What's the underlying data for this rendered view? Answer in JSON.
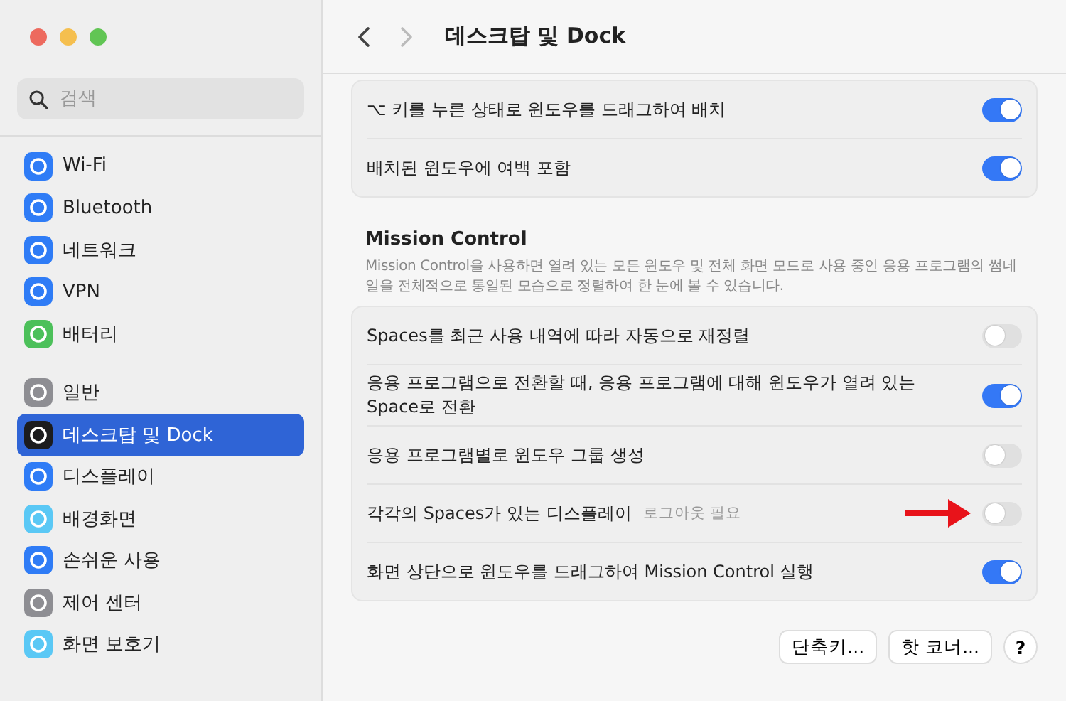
{
  "sidebar": {
    "search": {
      "placeholder": "검색"
    },
    "groups": [
      {
        "items": [
          {
            "label": "Wi-Fi",
            "color": "#2f7cf6",
            "selected": false
          },
          {
            "label": "Bluetooth",
            "color": "#2f7cf6",
            "selected": false
          },
          {
            "label": "네트워크",
            "color": "#2f7cf6",
            "selected": false
          },
          {
            "label": "VPN",
            "color": "#2f7cf6",
            "selected": false
          },
          {
            "label": "배터리",
            "color": "#4cc05a",
            "selected": false
          }
        ]
      },
      {
        "items": [
          {
            "label": "일반",
            "color": "#8e8e93",
            "selected": false
          },
          {
            "label": "데스크탑 및 Dock",
            "color": "#1c1c1e",
            "selected": true
          },
          {
            "label": "디스플레이",
            "color": "#2f7cf6",
            "selected": false
          },
          {
            "label": "배경화면",
            "color": "#5ac8f5",
            "selected": false
          },
          {
            "label": "손쉬운 사용",
            "color": "#2f7cf6",
            "selected": false
          },
          {
            "label": "제어 센터",
            "color": "#8e8e93",
            "selected": false
          },
          {
            "label": "화면 보호기",
            "color": "#5ac8f5",
            "selected": false
          }
        ]
      }
    ]
  },
  "header": {
    "title": "데스크탑 및 Dock"
  },
  "sections": [
    {
      "rows": [
        {
          "label": "⌥ 키를 누른 상태로 윈도우를 드래그하여 배치",
          "on": true,
          "highlighted": false
        },
        {
          "label": "배치된 윈도우에 여백 포함",
          "on": true,
          "highlighted": false
        }
      ]
    },
    {
      "heading": "Mission Control",
      "description": "Mission Control을 사용하면 열려 있는 모든 윈도우 및 전체 화면 모드로 사용 중인 응용 프로그램의 썸네일을 전체적으로 통일된 모습으로 정렬하여 한 눈에 볼 수 있습니다.",
      "rows": [
        {
          "label": "Spaces를 최근 사용 내역에 따라 자동으로 재정렬",
          "on": false,
          "highlighted": false
        },
        {
          "label": "응용 프로그램으로 전환할 때, 응용 프로그램에 대해 윈도우가 열려 있는 Space로 전환",
          "on": true,
          "highlighted": false
        },
        {
          "label": "응용 프로그램별로 윈도우 그룹 생성",
          "on": false,
          "highlighted": false
        },
        {
          "label": "각각의 Spaces가 있는 디스플레이",
          "note": "로그아웃 필요",
          "on": false,
          "highlighted": true
        },
        {
          "label": "화면 상단으로 윈도우를 드래그하여 Mission Control 실행",
          "on": true,
          "highlighted": false
        }
      ]
    }
  ],
  "buttons": [
    {
      "label": "단축키..."
    },
    {
      "label": "핫 코너..."
    },
    {
      "label": "?"
    }
  ]
}
